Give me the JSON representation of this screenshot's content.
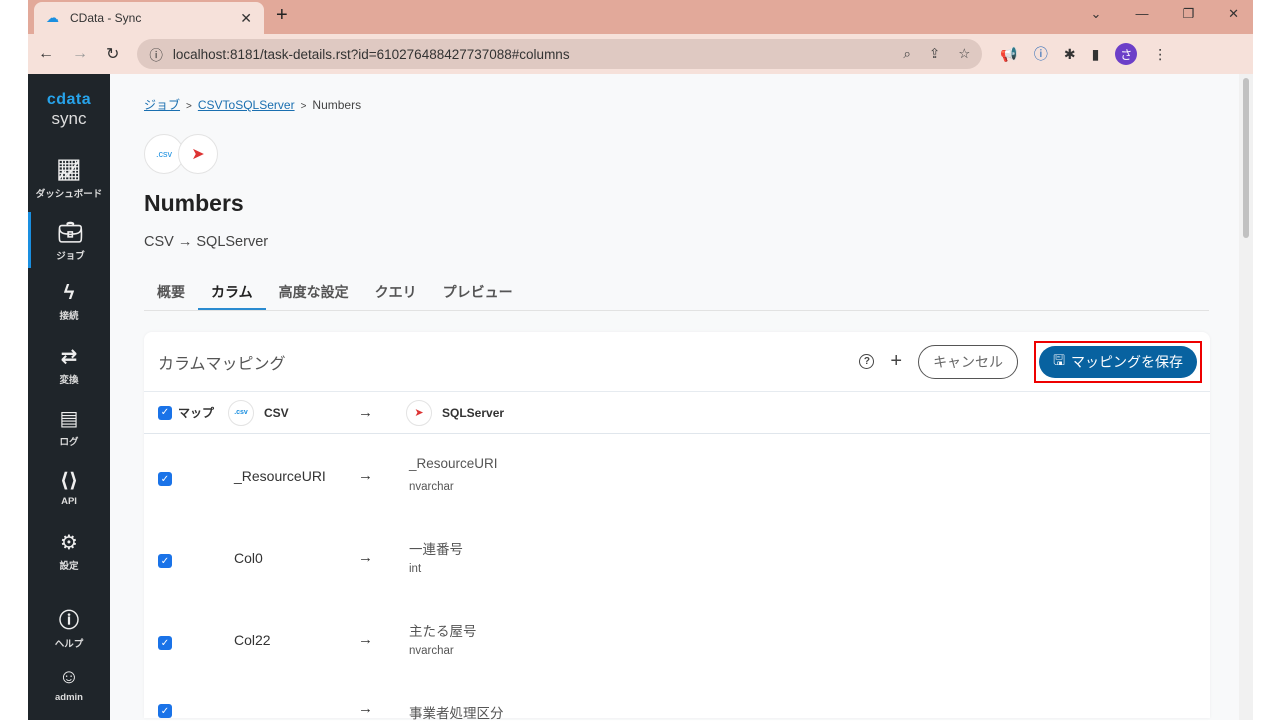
{
  "browser": {
    "tab_title": "CData - Sync",
    "url": "localhost:8181/task-details.rst?id=610276488427737088#columns",
    "profile_initial": "さ"
  },
  "sidebar": {
    "logo_top": "cdata",
    "logo_bottom": "sync",
    "items": [
      {
        "label": "ダッシュボード",
        "icon": "chart-line-icon"
      },
      {
        "label": "ジョブ",
        "icon": "briefcase-icon"
      },
      {
        "label": "接続",
        "icon": "bolt-icon"
      },
      {
        "label": "変換",
        "icon": "swap-icon"
      },
      {
        "label": "ログ",
        "icon": "book-icon"
      },
      {
        "label": "API",
        "icon": "code-file-icon"
      },
      {
        "label": "設定",
        "icon": "gear-icon"
      },
      {
        "label": "ヘルプ",
        "icon": "help-icon"
      },
      {
        "label": "admin",
        "icon": "user-icon"
      }
    ]
  },
  "breadcrumb": {
    "items": [
      "ジョブ",
      "CSVToSQLServer",
      "Numbers"
    ],
    "sep": ">"
  },
  "page": {
    "csv_badge": ".csv",
    "title": "Numbers",
    "subtitle": "CSV → SQLServer"
  },
  "tabs": [
    "概要",
    "カラム",
    "高度な設定",
    "クエリ",
    "プレビュー"
  ],
  "card": {
    "title": "カラムマッピング",
    "help": "?",
    "add": "+",
    "cancel": "キャンセル",
    "save": "マッピングを保存",
    "header": {
      "map": "マップ",
      "source": "CSV",
      "source_badge": ".csv",
      "arrow": "→",
      "dest": "SQLServer"
    },
    "rows": [
      {
        "source": "_ResourceURI",
        "arrow": "→",
        "dest": "_ResourceURI",
        "type": "nvarchar"
      },
      {
        "source": "Col0",
        "arrow": "→",
        "dest": "一連番号",
        "type": "int"
      },
      {
        "source": "Col22",
        "arrow": "→",
        "dest": "主たる屋号",
        "type": "nvarchar"
      },
      {
        "source": "",
        "arrow": "→",
        "dest": "事業者処理区分",
        "type": ""
      }
    ]
  }
}
